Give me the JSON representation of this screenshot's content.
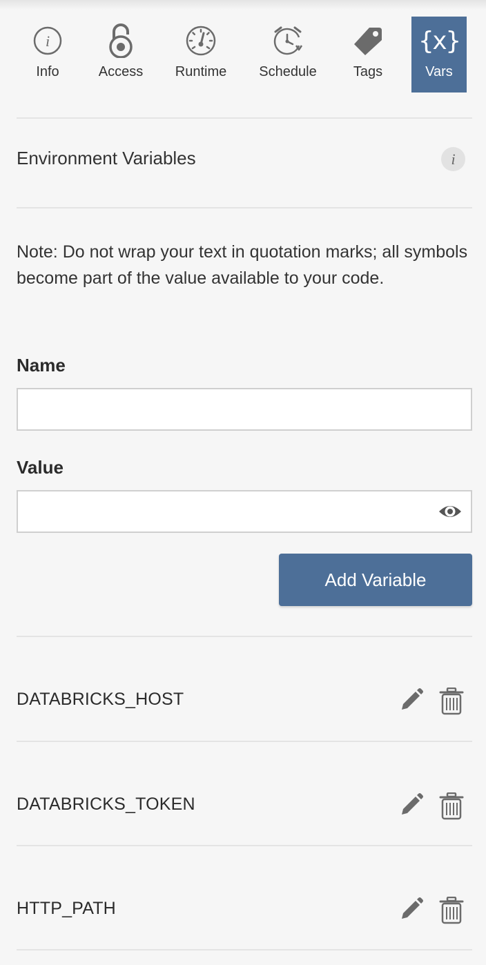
{
  "tabs": [
    {
      "label": "Info",
      "icon": "info-circle-icon"
    },
    {
      "label": "Access",
      "icon": "padlock-icon"
    },
    {
      "label": "Runtime",
      "icon": "speedometer-icon"
    },
    {
      "label": "Schedule",
      "icon": "clock-icon"
    },
    {
      "label": "Tags",
      "icon": "tag-icon"
    },
    {
      "label": "Vars",
      "icon": "variables-icon",
      "icon_text": "{x}",
      "active": true
    }
  ],
  "section": {
    "title": "Environment Variables",
    "info_icon_text": "i"
  },
  "note": "Note: Do not wrap your text in quotation marks; all symbols become part of the value available to your code.",
  "form": {
    "name_label": "Name",
    "name_value": "",
    "value_label": "Value",
    "value_value": "",
    "add_button_label": "Add Variable"
  },
  "variables": [
    {
      "name": "DATABRICKS_HOST"
    },
    {
      "name": "DATABRICKS_TOKEN"
    },
    {
      "name": "HTTP_PATH"
    }
  ],
  "colors": {
    "accent": "#4d6f98",
    "background": "#f6f6f6",
    "divider": "#e4e4e4",
    "icon_gray": "#6b6b6b"
  }
}
